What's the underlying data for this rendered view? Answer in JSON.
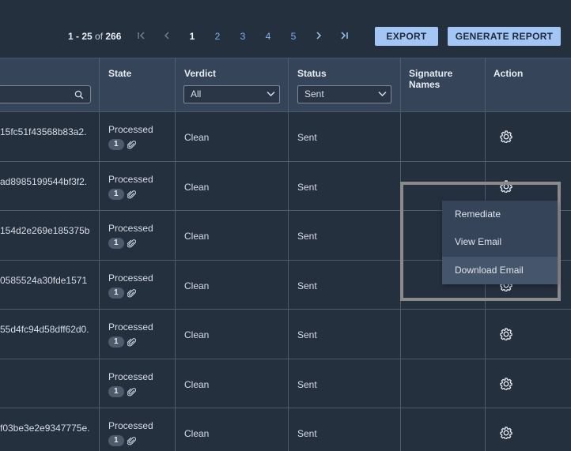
{
  "pagination": {
    "range_bold": "1 - 25",
    "of_text": " of ",
    "total": "266",
    "pages": [
      "1",
      "2",
      "3",
      "4",
      "5"
    ],
    "current_page": "1"
  },
  "toolbar": {
    "export_label": "EXPORT",
    "report_label": "GENERATE REPORT"
  },
  "columns": {
    "state": "State",
    "verdict": "Verdict",
    "status": "Status",
    "signature_line1": "Signature",
    "signature_line2": "Names",
    "action": "Action"
  },
  "filters": {
    "verdict_selected": "All",
    "status_selected": "Sent"
  },
  "rows": [
    {
      "id": "15fc51f43568b83a2.",
      "state": "Processed",
      "attachments": "1",
      "verdict": "Clean",
      "status": "Sent"
    },
    {
      "id": "ad8985199544bf3f2.",
      "state": "Processed",
      "attachments": "1",
      "verdict": "Clean",
      "status": "Sent"
    },
    {
      "id": "154d2e269e185375b",
      "state": "Processed",
      "attachments": "1",
      "verdict": "Clean",
      "status": "Sent"
    },
    {
      "id": "0585524a30fde1571",
      "state": "Processed",
      "attachments": "1",
      "verdict": "Clean",
      "status": "Sent"
    },
    {
      "id": "55d4fc94d58dff62d0.",
      "state": "Processed",
      "attachments": "1",
      "verdict": "Clean",
      "status": "Sent"
    },
    {
      "id": "",
      "state": "Processed",
      "attachments": "1",
      "verdict": "Clean",
      "status": "Sent"
    },
    {
      "id": "f03be3e2e9347775e.",
      "state": "Processed",
      "attachments": "1",
      "verdict": "Clean",
      "status": "Sent"
    }
  ],
  "context_menu": {
    "items": [
      "Remediate",
      "View Email",
      "Download Email"
    ],
    "hovered": "Download Email"
  },
  "colors": {
    "background": "#25303f",
    "header": "#364459",
    "accent_button": "#a3c6f5",
    "link": "#7fb0f0"
  }
}
